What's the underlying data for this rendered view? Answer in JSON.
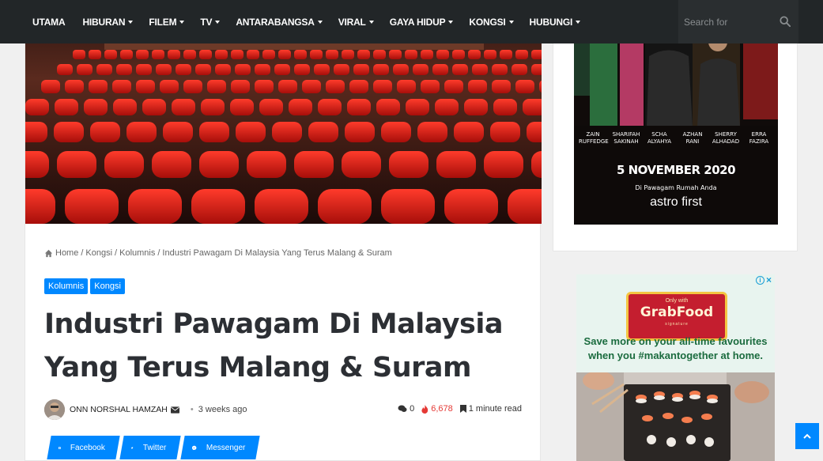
{
  "nav": {
    "items": [
      {
        "label": "UTAMA",
        "dropdown": false
      },
      {
        "label": "HIBURAN",
        "dropdown": true
      },
      {
        "label": "FILEM",
        "dropdown": true
      },
      {
        "label": "TV",
        "dropdown": true
      },
      {
        "label": "ANTARABANGSA",
        "dropdown": true
      },
      {
        "label": "VIRAL",
        "dropdown": true
      },
      {
        "label": "GAYA HIDUP",
        "dropdown": true
      },
      {
        "label": "KONGSI",
        "dropdown": true
      },
      {
        "label": "HUBUNGI",
        "dropdown": true
      }
    ],
    "search_placeholder": "Search for"
  },
  "breadcrumb": {
    "home": "Home",
    "items": [
      "Kongsi",
      "Kolumnis",
      "Industri Pawagam Di Malaysia Yang Terus Malang & Suram"
    ],
    "separator": "/"
  },
  "categories": [
    "Kolumnis",
    "Kongsi"
  ],
  "article": {
    "title": "Industri Pawagam Di Malaysia Yang Terus Malang & Suram",
    "author": "ONN NORSHAL HAMZAH",
    "date": "3 weeks ago",
    "comments": "0",
    "views": "6,678",
    "read_time": "1 minute read"
  },
  "share": {
    "facebook": "Facebook",
    "twitter": "Twitter",
    "messenger": "Messenger"
  },
  "poster": {
    "cast": [
      "ZAIN RUFFEDGE",
      "SHARIFAH SAKINAH",
      "SCHA ALYAHYA",
      "AZHAN RANI",
      "SHERRY ALHADAD",
      "ERRA FAZIRA"
    ],
    "date": "5 NOVEMBER 2020",
    "tagline": "Di Pawagam Rumah Anda",
    "brand": "astro first"
  },
  "ad": {
    "only_with": "Only with",
    "brand": "GrabFood",
    "signature": "signature",
    "copy_line1": "Save more on your all-time favourites",
    "copy_line2": "when you #makantogether at home."
  },
  "colors": {
    "nav_bg": "#222628",
    "accent": "#0088ff",
    "title": "#2c2f34",
    "views": "#e53935"
  }
}
